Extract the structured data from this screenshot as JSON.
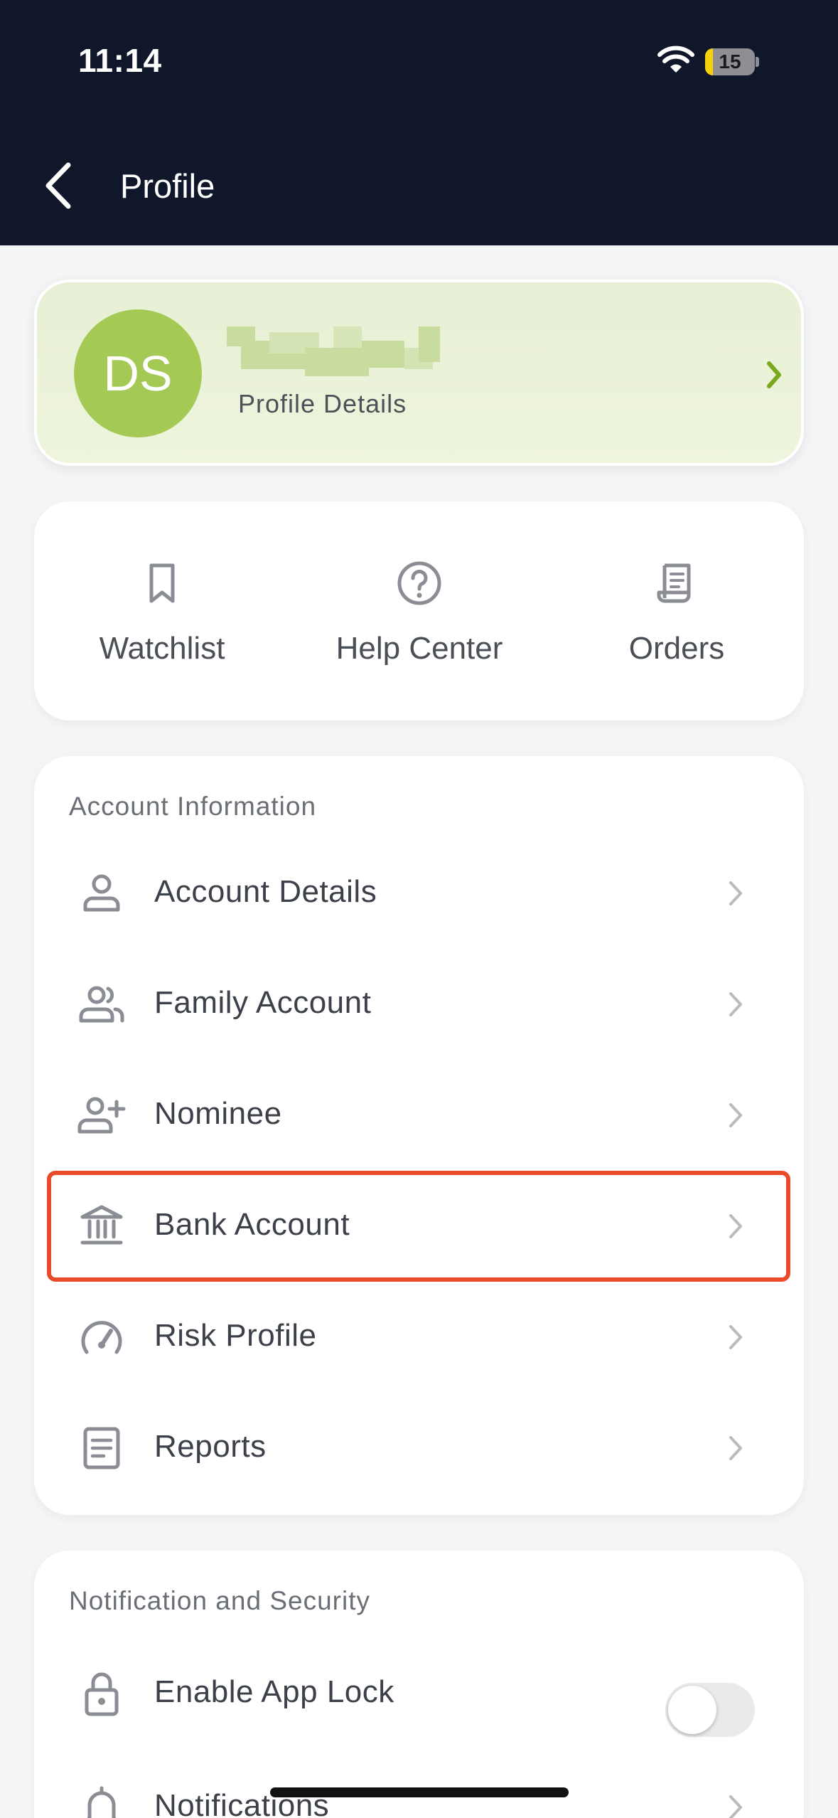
{
  "status_bar": {
    "time": "11:14",
    "battery_level": "15",
    "battery_fraction": 0.15
  },
  "header": {
    "title": "Profile"
  },
  "profile": {
    "initials": "DS",
    "subtitle": "Profile Details"
  },
  "quick_actions": [
    {
      "label": "Watchlist",
      "icon": "bookmark-icon"
    },
    {
      "label": "Help Center",
      "icon": "question-circle-icon"
    },
    {
      "label": "Orders",
      "icon": "receipt-icon"
    }
  ],
  "account_section": {
    "title": "Account Information",
    "items": [
      {
        "label": "Account Details",
        "icon": "user-icon"
      },
      {
        "label": "Family Account",
        "icon": "users-icon"
      },
      {
        "label": "Nominee",
        "icon": "user-plus-icon"
      },
      {
        "label": "Bank Account",
        "icon": "bank-icon"
      },
      {
        "label": "Risk Profile",
        "icon": "gauge-icon"
      },
      {
        "label": "Reports",
        "icon": "document-icon"
      }
    ]
  },
  "notification_section": {
    "title": "Notification and Security",
    "items": [
      {
        "label": "Enable App Lock",
        "icon": "lock-icon",
        "toggle_on": false
      },
      {
        "label": "Notifications",
        "icon": "bell-icon"
      }
    ]
  },
  "colors": {
    "header_bg": "#11172a",
    "avatar_bg": "#a5c955",
    "accent_green": "#7aa81e",
    "highlight": "#e84a2a"
  }
}
